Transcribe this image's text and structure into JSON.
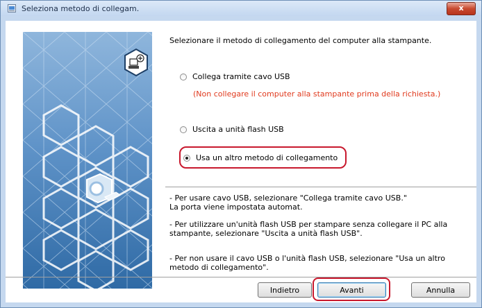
{
  "window": {
    "title": "Seleziona metodo di collegam.",
    "close_label": "x"
  },
  "instruction": "Selezionare il metodo di collegamento del computer alla stampante.",
  "options": [
    {
      "label": "Collega tramite cavo USB",
      "selected": false
    },
    {
      "label": "Uscita a unità flash USB",
      "selected": false
    },
    {
      "label": "Usa un altro metodo di collegamento",
      "selected": true
    }
  ],
  "usb_warning": "(Non collegare il computer alla stampante prima della richiesta.)",
  "notes": [
    {
      "line1": "- Per usare cavo USB, selezionare \"Collega tramite cavo USB.\"",
      "line2": "La porta viene impostata automat."
    },
    {
      "line1": "- Per utilizzare un'unità flash USB per stampare senza collegare il PC alla",
      "line2": "stampante, selezionare \"Uscita a unità flash USB\"."
    },
    {
      "line1": "- Per non usare il cavo USB o l'unità flash USB, selezionare \"Usa un altro",
      "line2": "metodo di collegamento\"."
    }
  ],
  "buttons": {
    "back": "Indietro",
    "next": "Avanti",
    "cancel": "Annulla"
  },
  "colors": {
    "warning": "#e03a1e",
    "highlight": "#c8182d",
    "sidebar": "#3f7ab3"
  },
  "icons": [
    "window-app-icon",
    "computer-connection-icon",
    "printer-icon"
  ]
}
